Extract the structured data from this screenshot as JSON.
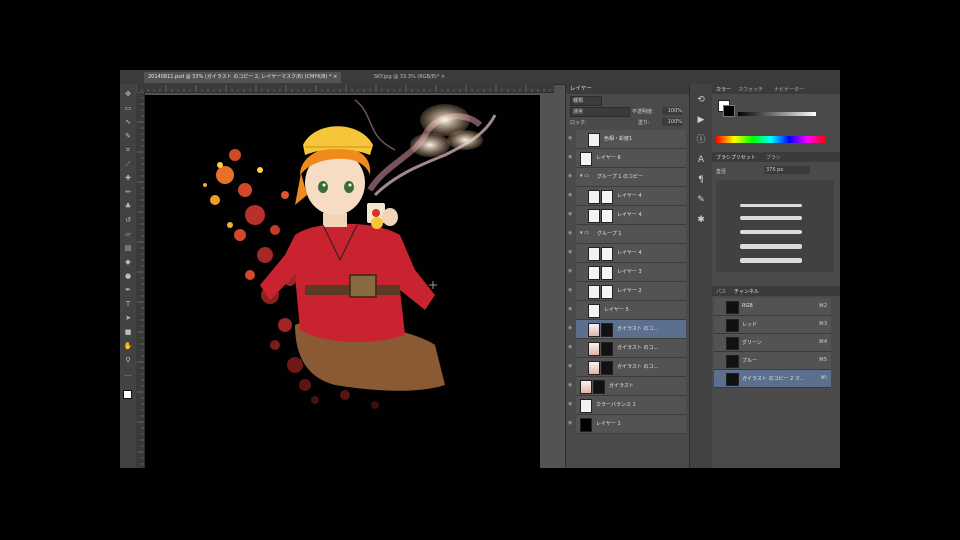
{
  "window": {
    "tabs": [
      {
        "label": "20140811.psd @ 33% (ガイラスト のコピー 2, レイヤーマスク/8) (CMYK/8) * ×",
        "active": true
      },
      {
        "label": "SKY.jpg @ 33.3% (RGB/8)* ×",
        "active": false
      }
    ]
  },
  "toolbar": {
    "tools": [
      "move-icon",
      "marquee-icon",
      "lasso-icon",
      "quick-select-icon",
      "crop-icon",
      "eyedropper-icon",
      "healing-icon",
      "brush-icon",
      "clone-stamp-icon",
      "history-brush-icon",
      "eraser-icon",
      "gradient-icon",
      "blur-icon",
      "dodge-icon",
      "pen-icon",
      "type-icon",
      "path-select-icon",
      "shape-icon",
      "hand-icon",
      "zoom-icon",
      "extra-icon"
    ]
  },
  "layers_panel": {
    "title": "レイヤー",
    "kind_filter": "種類",
    "blend_mode": "通常",
    "opacity_label": "不透明度:",
    "opacity_value": "100%",
    "lock_label": "ロック:",
    "fill_label": "塗り:",
    "fill_value": "100%",
    "layers": [
      {
        "name": "色相・彩度1",
        "indent": 1,
        "type": "adjust",
        "selected": false
      },
      {
        "name": "レイヤー 6",
        "indent": 0,
        "type": "plain",
        "selected": false
      },
      {
        "name": "グループ 1 のコピー",
        "indent": 0,
        "type": "group",
        "selected": false
      },
      {
        "name": "レイヤー 4",
        "indent": 1,
        "type": "mask",
        "selected": false
      },
      {
        "name": "レイヤー 4",
        "indent": 1,
        "type": "mask",
        "selected": false
      },
      {
        "name": "グループ 1",
        "indent": 0,
        "type": "group",
        "selected": false
      },
      {
        "name": "レイヤー 4",
        "indent": 1,
        "type": "mask",
        "selected": false
      },
      {
        "name": "レイヤー 3",
        "indent": 1,
        "type": "mask",
        "selected": false
      },
      {
        "name": "レイヤー 2",
        "indent": 1,
        "type": "mask",
        "selected": false
      },
      {
        "name": "レイヤー 5",
        "indent": 1,
        "type": "plain",
        "selected": false
      },
      {
        "name": "ガイラスト のコ...",
        "indent": 1,
        "type": "art",
        "selected": true
      },
      {
        "name": "ガイラスト のコ...",
        "indent": 1,
        "type": "art",
        "selected": false
      },
      {
        "name": "ガイラスト のコ...",
        "indent": 1,
        "type": "art",
        "selected": false
      },
      {
        "name": "ガイラスト",
        "indent": 0,
        "type": "art",
        "selected": false
      },
      {
        "name": "カラーバランス 1",
        "indent": 0,
        "type": "adjust",
        "selected": false
      },
      {
        "name": "レイヤー 1",
        "indent": 0,
        "type": "black",
        "selected": false
      }
    ]
  },
  "color_panel": {
    "tabs": [
      "カラー",
      "スウォッチ",
      "ナビゲーター"
    ]
  },
  "brush_panel": {
    "tabs": [
      "ブラシプリセット",
      "ブラシ"
    ],
    "size_label": "直径",
    "size_value": "375 px"
  },
  "channels_panel": {
    "tabs": [
      "パス",
      "チャンネル"
    ],
    "channels": [
      {
        "name": "RGB",
        "key": "⌘2",
        "selected": false
      },
      {
        "name": "レッド",
        "key": "⌘3",
        "selected": false
      },
      {
        "name": "グリーン",
        "key": "⌘4",
        "selected": false
      },
      {
        "name": "ブルー",
        "key": "⌘5",
        "selected": false
      },
      {
        "name": "ガイラスト のコピー 2 マ...",
        "key": "⌘\\",
        "selected": true
      }
    ]
  },
  "colors": {
    "app_bg": "#535353",
    "panel_bg": "#4a4a4a",
    "selection": "#5c6f8f",
    "canvas_bg": "#020101",
    "character_hair": "#f08a1c",
    "character_shirt": "#c8232f",
    "character_pants": "#8a5a34",
    "splatter": "#d2492a"
  }
}
